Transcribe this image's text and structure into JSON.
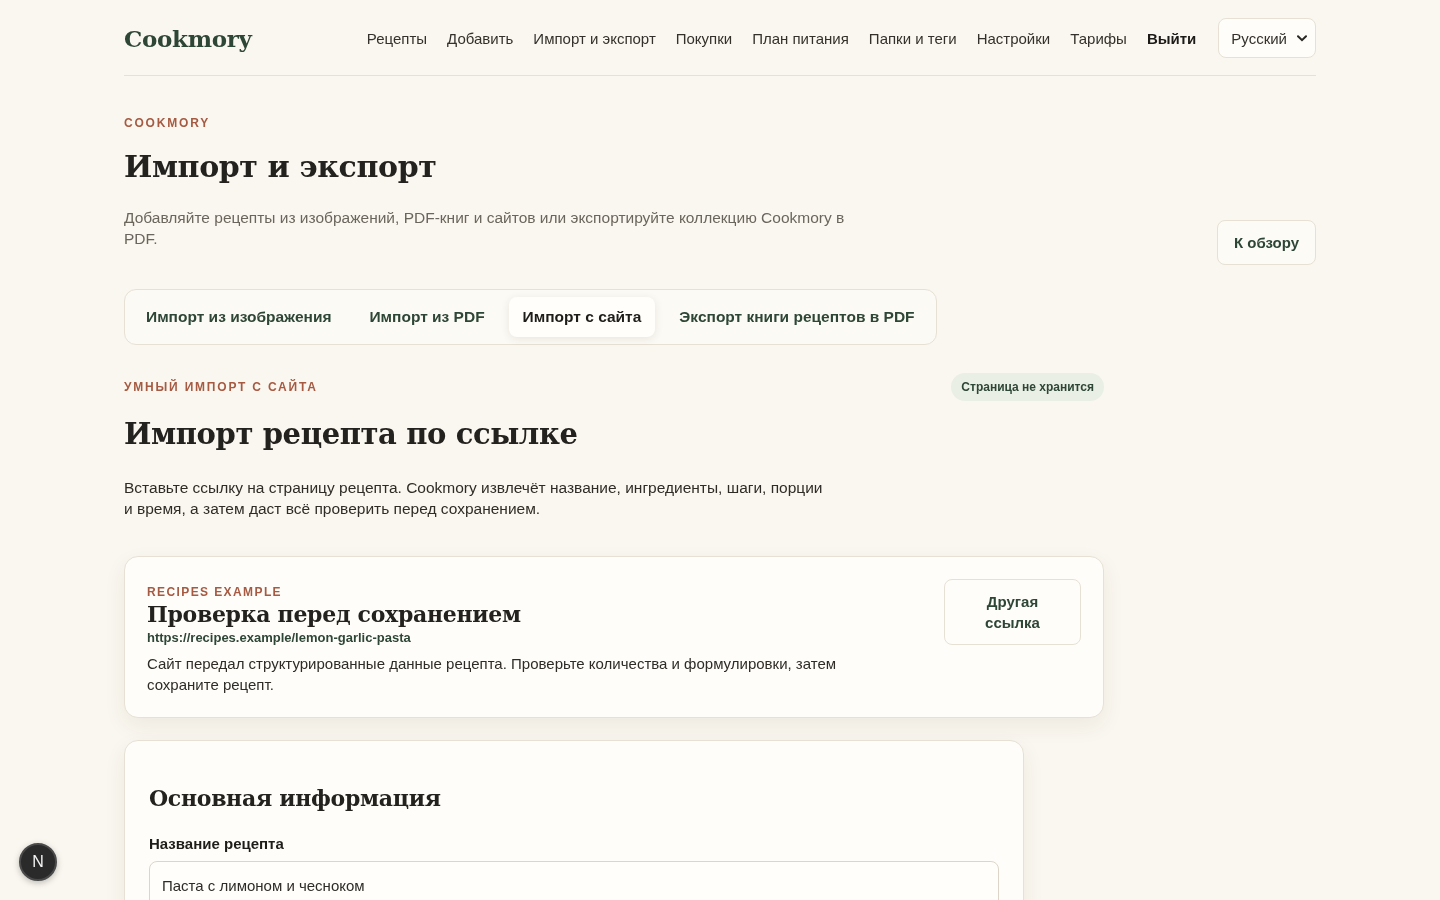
{
  "header": {
    "logo": "Cookmory",
    "nav": [
      {
        "label": "Рецепты",
        "kind": "link"
      },
      {
        "label": "Добавить",
        "kind": "link"
      },
      {
        "label": "Импорт и экспорт",
        "kind": "link"
      },
      {
        "label": "Покупки",
        "kind": "link"
      },
      {
        "label": "План питания",
        "kind": "link"
      },
      {
        "label": "Папки и теги",
        "kind": "link"
      },
      {
        "label": "Настройки",
        "kind": "link"
      },
      {
        "label": "Тарифы",
        "kind": "link"
      },
      {
        "label": "Выйти",
        "kind": "action"
      }
    ],
    "language": {
      "value": "Русский"
    }
  },
  "page": {
    "eyebrow": "COOKMORY",
    "title": "Импорт и экспорт",
    "description": "Добавляйте рецепты из изображений, PDF-книг и сайтов или экспортируйте коллекцию Cookmory в PDF.",
    "back_button": "К обзору"
  },
  "tabs": [
    {
      "label": "Импорт из изображения",
      "selected": false
    },
    {
      "label": "Импорт из PDF",
      "selected": false
    },
    {
      "label": "Импорт с сайта",
      "selected": true
    },
    {
      "label": "Экспорт книги рецептов в PDF",
      "selected": false
    }
  ],
  "import_section": {
    "eyebrow": "УМНЫЙ ИМПОРТ С САЙТА",
    "badge": "Страница не хранится",
    "title": "Импорт рецепта по ссылке",
    "description": "Вставьте ссылку на страницу рецепта. Cookmory извлечёт название, ингредиенты, шаги, порции и время, а затем даст всё проверить перед сохранением."
  },
  "review_card": {
    "source": "RECIPES EXAMPLE",
    "title": "Проверка перед сохранением",
    "url": "https://recipes.example/lemon-garlic-pasta",
    "message": "Сайт передал структурированные данные рецепта. Проверьте количества и формулировки, затем сохраните рецепт.",
    "button": "Другая ссылка"
  },
  "basic_info": {
    "title": "Основная информация",
    "fields": [
      {
        "label": "Название рецепта",
        "value": "Паста с лимоном и чесноком"
      }
    ]
  },
  "dev_indicator": {
    "label": "N"
  }
}
